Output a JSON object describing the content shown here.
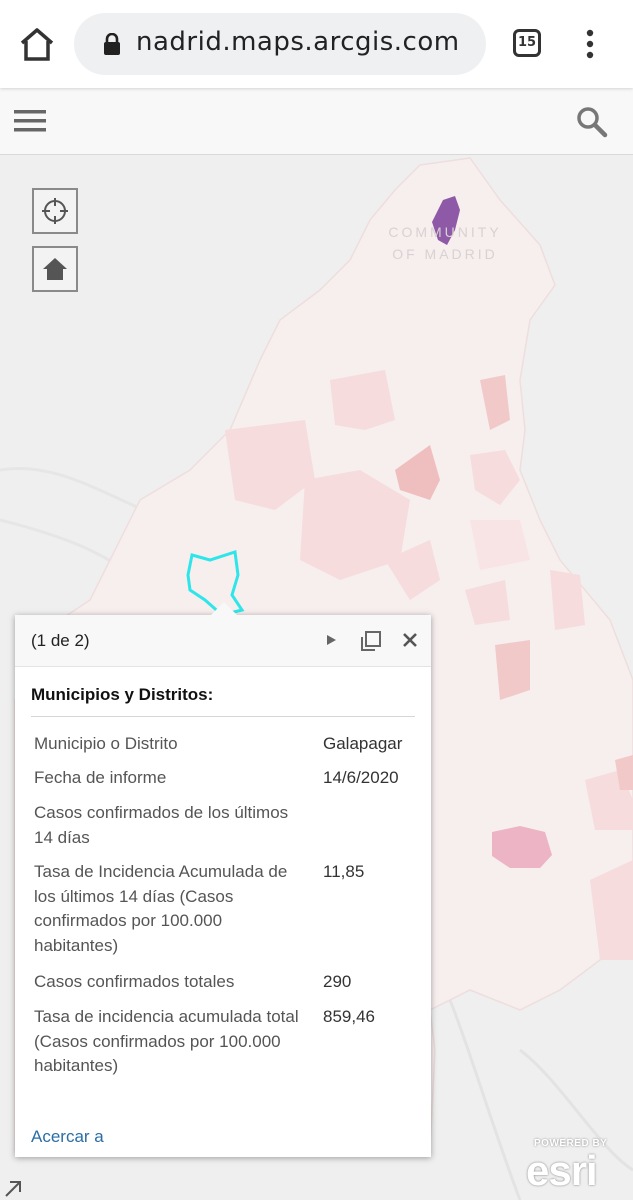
{
  "browser": {
    "url": "nadrid.maps.arcgis.com",
    "tab_count": "15"
  },
  "map": {
    "region_label_line1": "COMMUNITY",
    "region_label_line2": "OF MADRID",
    "colors": {
      "region_fill": "#f7eeee",
      "low_incidence": "#f6dcdc",
      "mid_incidence": "#f2c9c9",
      "high_incidence": "#ecb4c4",
      "top_incidence": "#8e5aa8",
      "selected_outline": "#2ee6ea"
    }
  },
  "popup": {
    "count": "(1 de 2)",
    "title": "Municipios y Distritos:",
    "fields": [
      {
        "label": "Municipio o Distrito",
        "value": "Galapagar"
      },
      {
        "label": "Fecha de informe",
        "value": "14/6/2020"
      },
      {
        "label": "Casos confirmados de los últimos 14 días",
        "value": ""
      },
      {
        "label": "Tasa de Incidencia Acumulada de los últimos 14 días (Casos confirmados por 100.000 habitantes)",
        "value": "11,85"
      },
      {
        "label": "Casos confirmados totales",
        "value": "290"
      },
      {
        "label": "Tasa de incidencia acumulada total (Casos confirmados por 100.000 habitantes)",
        "value": "859,46"
      }
    ],
    "zoom_link": "Acercar a"
  },
  "attribution": {
    "powered_by": "POWERED BY",
    "logo": "esri"
  }
}
